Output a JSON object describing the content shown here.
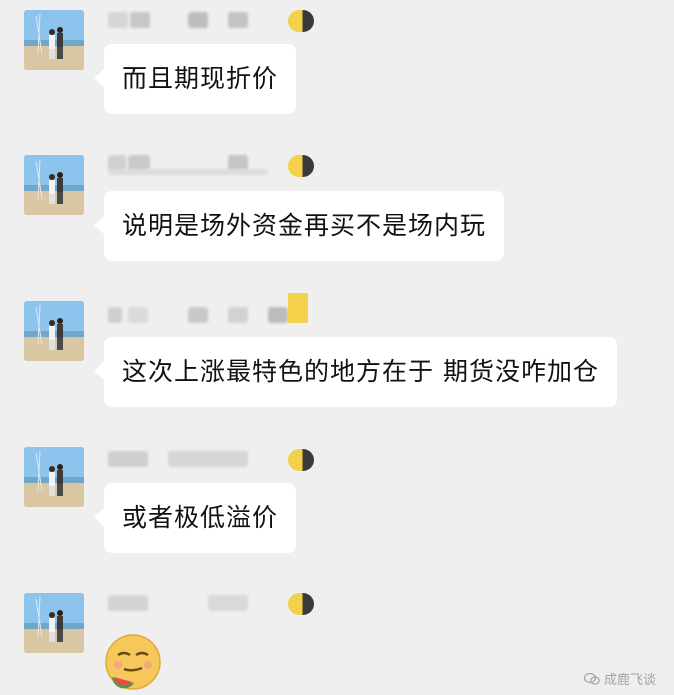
{
  "messages": [
    {
      "text": "而且期现折价",
      "avatar_icon": "couple-beach-avatar"
    },
    {
      "text": "说明是场外资金再买不是场内玩",
      "avatar_icon": "couple-beach-avatar"
    },
    {
      "text": "这次上涨最特色的地方在于 期货没咋加仓",
      "avatar_icon": "couple-beach-avatar"
    },
    {
      "text": "或者极低溢价",
      "avatar_icon": "couple-beach-avatar"
    },
    {
      "sticker": "smirk-watermelon-emoji",
      "avatar_icon": "couple-beach-avatar"
    }
  ],
  "watermark": {
    "icon": "wechat-official-icon",
    "text": "成鹿飞谈"
  },
  "colors": {
    "background": "#efefef",
    "bubble": "#ffffff",
    "text": "#111111"
  }
}
